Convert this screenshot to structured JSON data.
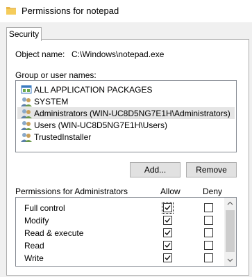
{
  "window": {
    "title": "Permissions for notepad"
  },
  "tabs": [
    {
      "label": "Security"
    }
  ],
  "object": {
    "label": "Object name:",
    "value": "C:\\Windows\\notepad.exe"
  },
  "groups": {
    "label": "Group or user names:",
    "items": [
      {
        "label": "ALL APPLICATION PACKAGES",
        "icon": "packages-icon",
        "selected": false
      },
      {
        "label": "SYSTEM",
        "icon": "users-icon",
        "selected": false
      },
      {
        "label": "Administrators (WIN-UC8D5NG7E1H\\Administrators)",
        "icon": "users-icon",
        "selected": true
      },
      {
        "label": "Users (WIN-UC8D5NG7E1H\\Users)",
        "icon": "users-icon",
        "selected": false
      },
      {
        "label": "TrustedInstaller",
        "icon": "users-icon",
        "selected": false
      }
    ]
  },
  "buttons": {
    "add": "Add...",
    "remove": "Remove"
  },
  "permissions": {
    "label": "Permissions for Administrators",
    "allow_header": "Allow",
    "deny_header": "Deny",
    "rows": [
      {
        "name": "Full control",
        "allow": true,
        "deny": false
      },
      {
        "name": "Modify",
        "allow": true,
        "deny": false
      },
      {
        "name": "Read & execute",
        "allow": true,
        "deny": false
      },
      {
        "name": "Read",
        "allow": true,
        "deny": false
      },
      {
        "name": "Write",
        "allow": true,
        "deny": false
      }
    ]
  },
  "colors": {
    "selected_row": "#e5e5e5",
    "button_bg": "#e1e1e1",
    "border": "#adadad"
  }
}
